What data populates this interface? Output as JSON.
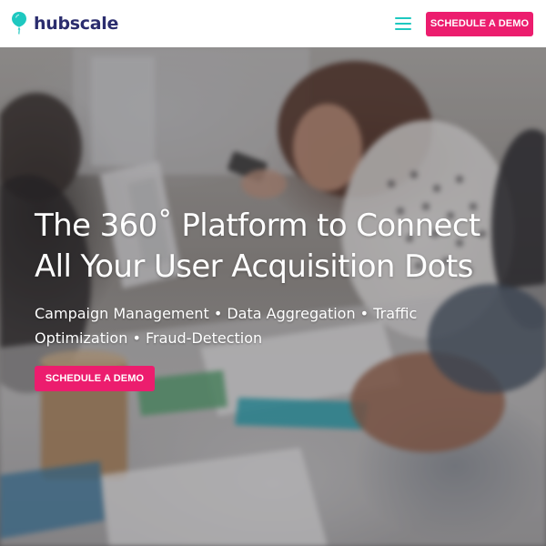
{
  "header": {
    "logo_text": "hubscale",
    "logo_icon": "balloon-pin-icon",
    "menu_icon": "hamburger-menu-icon",
    "cta_label": "SCHEDULE A DEMO"
  },
  "hero": {
    "title_line1": "The 360˚ Platform to Connect",
    "title_line2": "All Your User Acquisition Dots",
    "subtitle": "Campaign Management • Data Aggregation • Traffic Optimization • Fraud-Detection",
    "cta_label": "SCHEDULE A DEMO",
    "background": "office-team-photo"
  },
  "colors": {
    "brand_navy": "#2b2d6e",
    "brand_teal": "#1ec8c0",
    "cta_pink": "#ec1d6e",
    "text_white": "#ffffff"
  }
}
